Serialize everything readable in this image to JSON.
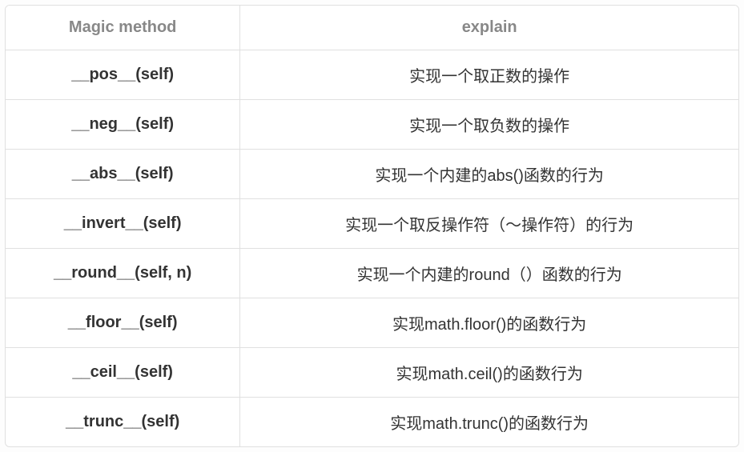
{
  "headers": {
    "method": "Magic method",
    "explain": "explain"
  },
  "rows": [
    {
      "method": "__pos__(self)",
      "explain": "实现一个取正数的操作"
    },
    {
      "method": "__neg__(self)",
      "explain": "实现一个取负数的操作"
    },
    {
      "method": "__abs__(self)",
      "explain": "实现一个内建的abs()函数的行为"
    },
    {
      "method": "__invert__(self)",
      "explain": "实现一个取反操作符（～操作符）的行为"
    },
    {
      "method": "__round__(self, n)",
      "explain": "实现一个内建的round（）函数的行为"
    },
    {
      "method": "__floor__(self)",
      "explain": "实现math.floor()的函数行为"
    },
    {
      "method": "__ceil__(self)",
      "explain": "实现math.ceil()的函数行为"
    },
    {
      "method": "__trunc__(self)",
      "explain": "实现math.trunc()的函数行为"
    }
  ]
}
